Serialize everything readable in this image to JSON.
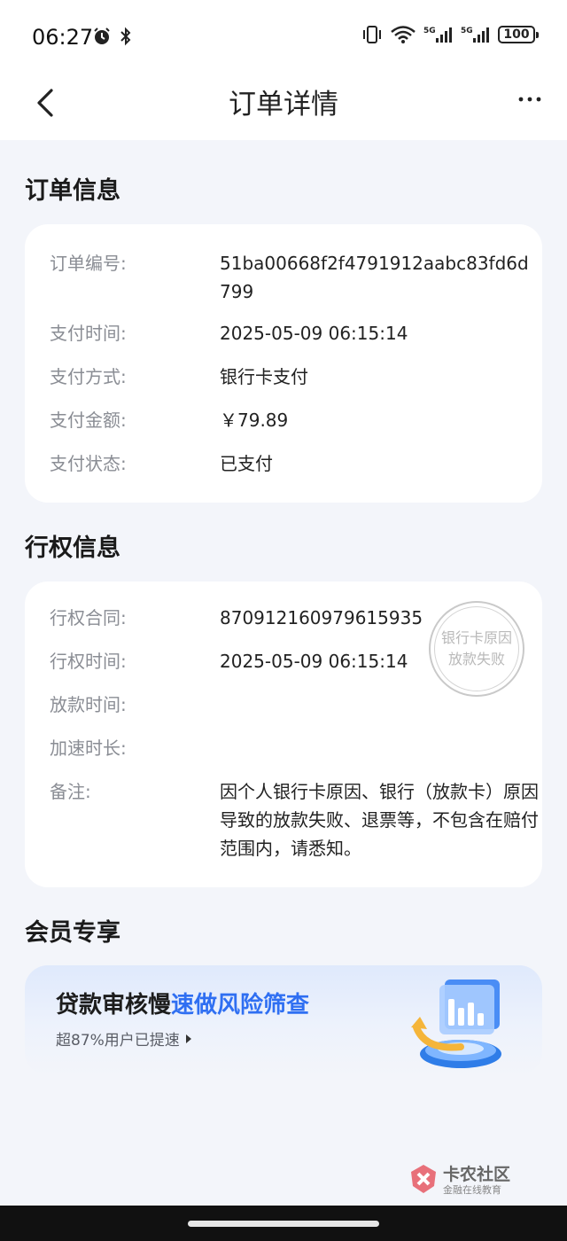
{
  "status": {
    "time": "06:27",
    "battery": "100",
    "network_a": "5G",
    "network_b": "5G"
  },
  "nav": {
    "title": "订单详情",
    "back_icon": "chevron-left-icon",
    "more_icon": "more-horizontal-icon"
  },
  "order_info": {
    "title": "订单信息",
    "rows": [
      {
        "label": "订单编号:",
        "value": "51ba00668f2f4791912aabc83fd6d799"
      },
      {
        "label": "支付时间:",
        "value": "2025-05-09 06:15:14"
      },
      {
        "label": "支付方式:",
        "value": "银行卡支付"
      },
      {
        "label": "支付金额:",
        "value": "￥79.89"
      },
      {
        "label": "支付状态:",
        "value": "已支付"
      }
    ]
  },
  "exercise_info": {
    "title": "行权信息",
    "rows": [
      {
        "label": "行权合同:",
        "value": "870912160979615935"
      },
      {
        "label": "行权时间:",
        "value": "2025-05-09 06:15:14"
      },
      {
        "label": "放款时间:",
        "value": ""
      },
      {
        "label": "加速时长:",
        "value": ""
      },
      {
        "label": "备注:",
        "value": "因个人银行卡原因、银行（放款卡）原因导致的放款失败、退票等，不包含在赔付范围内，请悉知。"
      }
    ],
    "stamp": {
      "line1": "银行卡原因",
      "line2": "放款失败"
    }
  },
  "member": {
    "title": "会员专享",
    "banner": {
      "title_plain": "贷款审核慢",
      "title_highlight": "速做风险筛查",
      "subtitle": "超87%用户已提速",
      "highlight_color": "#2f6ff2"
    }
  },
  "watermark": {
    "name": "卡农社区",
    "slogan": "金融在线教育"
  }
}
